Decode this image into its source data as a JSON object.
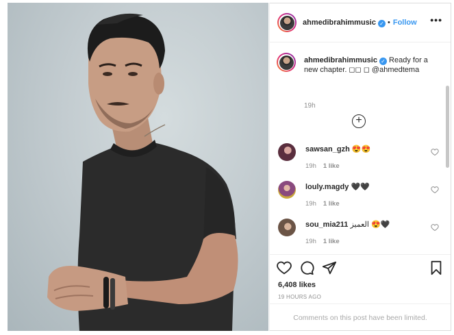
{
  "post": {
    "username": "ahmedibrahimmusic",
    "follow_label": "Follow",
    "dot": "•",
    "more_label": "•••"
  },
  "caption": {
    "username": "ahmedibrahimmusic",
    "text": "Ready for a new chapter. ◻◻ ◻ @ahmedtema",
    "time": "19h"
  },
  "load_more_label": "+",
  "comments": [
    {
      "username": "sawsan_gzh",
      "text": "😍😍",
      "time": "19h",
      "likes": "1 like"
    },
    {
      "username": "louly.magdy",
      "text": "🖤🖤",
      "time": "19h",
      "likes": "1 like"
    },
    {
      "username": "sou_mia211",
      "text": "العميز 😍🖤",
      "time": "19h",
      "likes": "1 like"
    }
  ],
  "footer": {
    "like_count": "6,408 likes",
    "post_time": "19 HOURS AGO",
    "comments_limited": "Comments on this post have been limited."
  },
  "colors": {
    "link_blue": "#3897f0",
    "secondary_text": "#8e8e8e",
    "border": "#dbdbdb"
  },
  "icons": [
    "heart-icon",
    "comment-icon",
    "share-icon",
    "bookmark-icon",
    "plus-circle-icon",
    "verified-badge-icon"
  ]
}
